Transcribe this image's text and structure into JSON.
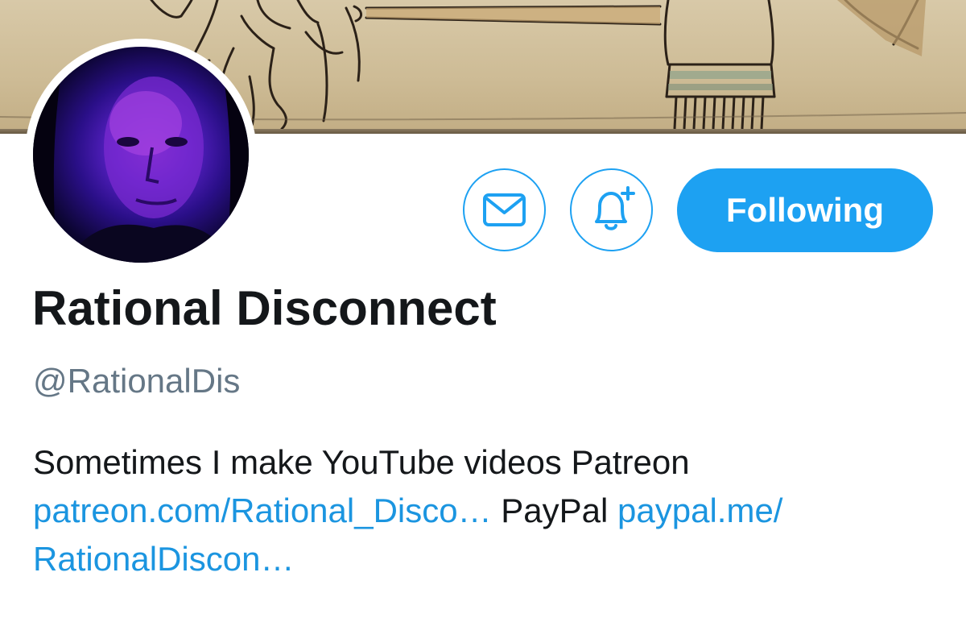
{
  "profile": {
    "display_name": "Rational Disconnect",
    "handle": "@RationalDis"
  },
  "actions": {
    "message_icon": "envelope-icon",
    "notify_icon": "bell-plus-icon",
    "follow_label": "Following"
  },
  "bio": {
    "text_1": "Sometimes I make YouTube videos Patreon",
    "link_1": "patreon.com/Rational_Disco…",
    "text_2": "PayPal",
    "link_2_line1": "paypal.me/",
    "link_2_line2": "RationalDiscon…"
  },
  "colors": {
    "accent": "#1da1f2",
    "link": "#1b95e0",
    "text": "#14171a",
    "muted": "#657786"
  }
}
